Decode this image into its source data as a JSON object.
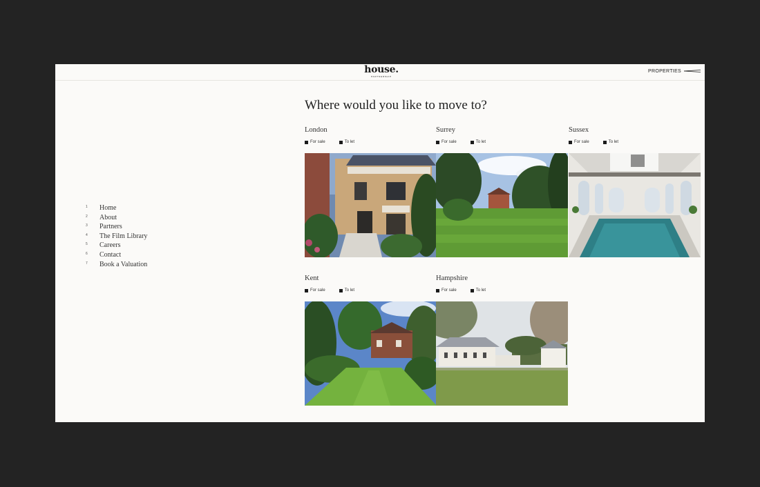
{
  "header": {
    "logo_word": "house.",
    "logo_sub": "PARTNERSHIP",
    "properties_label": "PROPERTIES"
  },
  "main": {
    "heading": "Where would you like to move to?"
  },
  "nav": {
    "items": [
      {
        "num": "1",
        "label": "Home"
      },
      {
        "num": "2",
        "label": "About"
      },
      {
        "num": "3",
        "label": "Partners"
      },
      {
        "num": "4",
        "label": "The Film Library"
      },
      {
        "num": "5",
        "label": "Careers"
      },
      {
        "num": "6",
        "label": "Contact"
      },
      {
        "num": "7",
        "label": "Book a Valuation"
      }
    ]
  },
  "regions": [
    {
      "name": "London",
      "for_sale": "For sale",
      "to_let": "To let",
      "photo_icon": "london-townhouse-photo"
    },
    {
      "name": "Surrey",
      "for_sale": "For sale",
      "to_let": "To let",
      "photo_icon": "surrey-garden-photo"
    },
    {
      "name": "Sussex",
      "for_sale": "For sale",
      "to_let": "To let",
      "photo_icon": "sussex-pool-photo"
    },
    {
      "name": "Kent",
      "for_sale": "For sale",
      "to_let": "To let",
      "photo_icon": "kent-garden-photo"
    },
    {
      "name": "Hampshire",
      "for_sale": "For sale",
      "to_let": "To let",
      "photo_icon": "hampshire-estate-photo"
    }
  ],
  "colors": {
    "frame": "#232323",
    "page": "#fbfaf8",
    "text": "#1b1b1b"
  }
}
